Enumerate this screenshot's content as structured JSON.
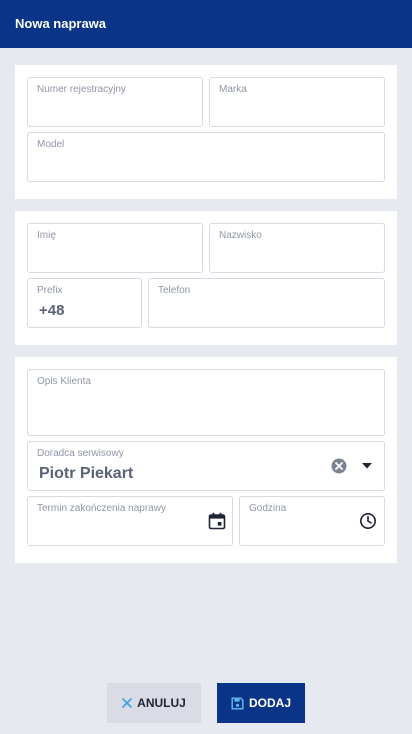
{
  "header": {
    "title": "Nowa naprawa"
  },
  "vehicle": {
    "registration_label": "Numer rejestracyjny",
    "make_label": "Marka",
    "model_label": "Model"
  },
  "customer": {
    "first_name_label": "Imię",
    "last_name_label": "Nazwisko",
    "prefix_label": "Prefix",
    "prefix_value": "+48",
    "phone_label": "Telefon"
  },
  "service": {
    "description_label": "Opis Klienta",
    "advisor_label": "Doradca serwisowy",
    "advisor_value": "Piotr Piekart",
    "due_date_label": "Termin zakończenia naprawy",
    "time_label": "Godzina"
  },
  "actions": {
    "cancel_label": "ANULUJ",
    "add_label": "DODAJ"
  },
  "colors": {
    "primary": "#0a3487",
    "background": "#e6e9f0",
    "cancel_icon": "#3aa0e6"
  },
  "icons": {
    "cancel": "close-icon",
    "add": "save-icon",
    "advisor_clear": "clear-icon",
    "advisor_dropdown": "dropdown-arrow-icon",
    "date_picker": "calendar-icon",
    "time_picker": "clock-icon"
  }
}
